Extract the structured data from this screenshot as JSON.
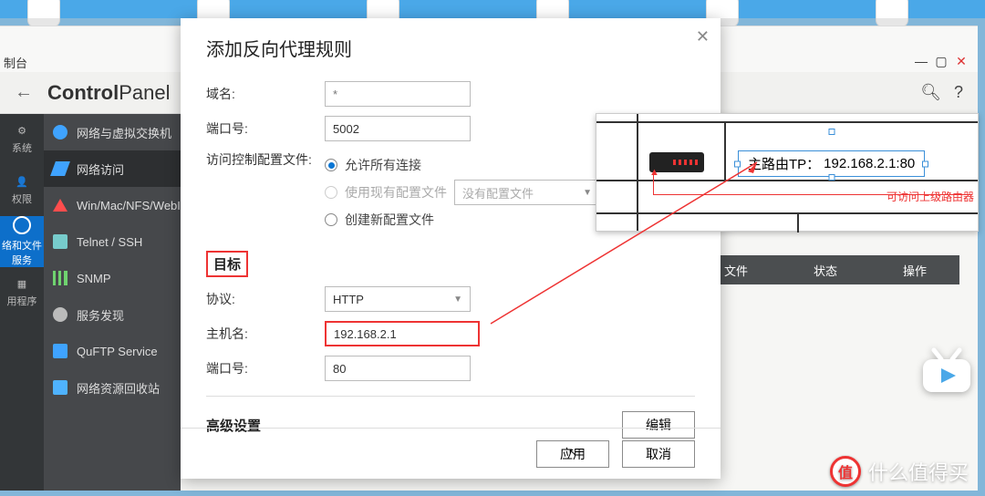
{
  "titlebar_fragment": "制台",
  "header": {
    "title_bold": "Control",
    "title_light": "Panel"
  },
  "rail": [
    {
      "label": "系统",
      "active": false
    },
    {
      "label": "权限",
      "active": false
    },
    {
      "label": "络和文件\n服务",
      "active": true
    },
    {
      "label": "用程序",
      "active": false
    }
  ],
  "sidebar": [
    {
      "label": "网络与虚拟交换机",
      "icon": "globe",
      "color": "#3fa3ff"
    },
    {
      "label": "网络访问",
      "icon": "net",
      "color": "#3fa3ff",
      "active": true
    },
    {
      "label": "Win/Mac/NFS/WebI",
      "icon": "triangle",
      "color": "#ff4d4d"
    },
    {
      "label": "Telnet / SSH",
      "icon": "terminal",
      "color": "#7cc"
    },
    {
      "label": "SNMP",
      "icon": "bars",
      "color": "#6fd36f"
    },
    {
      "label": "服务发现",
      "icon": "radar",
      "color": "#bbb"
    },
    {
      "label": "QuFTP Service",
      "icon": "ftp",
      "color": "#3fa3ff"
    },
    {
      "label": "网络资源回收站",
      "icon": "trash",
      "color": "#4fb3ff"
    }
  ],
  "table_headers": [
    "文件",
    "状态",
    "操作"
  ],
  "dialog": {
    "title": "添加反向代理规则",
    "domain_label": "域名:",
    "domain_placeholder": "*",
    "port_label": "端口号:",
    "port_value": "5002",
    "acl_label": "访问控制配置文件:",
    "radio_allow": "允许所有连接",
    "radio_existing": "使用现有配置文件",
    "existing_select": "没有配置文件",
    "radio_create": "创建新配置文件",
    "target_section": "目标",
    "proto_label": "协议:",
    "proto_value": "HTTP",
    "host_label": "主机名:",
    "host_value": "192.168.2.1",
    "target_port_label": "端口号:",
    "target_port_value": "80",
    "advanced_section": "高级设置",
    "edit_btn": "编辑",
    "apply_btn": "应用",
    "cancel_btn": "取消"
  },
  "diagram": {
    "label_prefix": "主路由TP：",
    "label_value": "192.168.2.1:80",
    "note": "可访问上级路由器"
  },
  "watermark": "什么值得买",
  "watermark_badge": "值"
}
